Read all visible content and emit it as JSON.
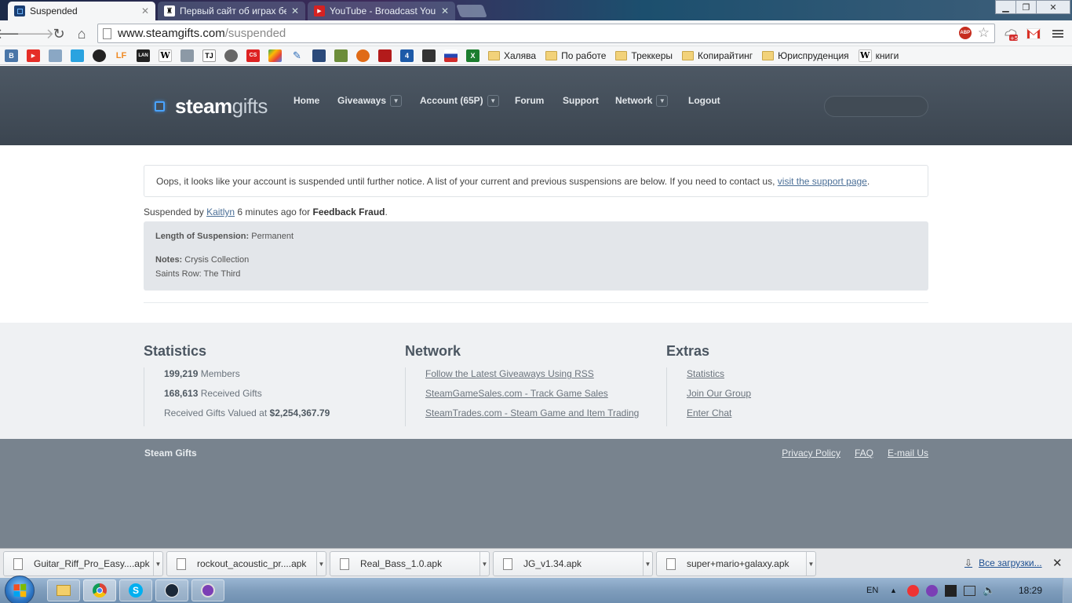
{
  "browser": {
    "tabs": [
      {
        "title": "Suspended",
        "active": true
      },
      {
        "title": "Первый сайт об играх без",
        "active": false
      },
      {
        "title": "YouTube - Broadcast Yours",
        "active": false
      }
    ],
    "url_host": "www.steamgifts.com",
    "url_path": "/suspended",
    "badge": "+5",
    "bookmark_icons": [
      "В",
      "▶",
      "",
      "",
      "",
      "LF",
      "LAN",
      "W",
      "",
      "TJ",
      "",
      "CS",
      "",
      "",
      "",
      "",
      "",
      "",
      "4",
      "",
      "",
      "X"
    ],
    "bookmark_folders": [
      "Халява",
      "По работе",
      "Треккеры",
      "Копирайтинг",
      "Юриспруденция"
    ],
    "bookmark_wiki": "книги"
  },
  "site": {
    "logo_a": "steam",
    "logo_b": "gifts",
    "nav": {
      "home": "Home",
      "giveaways": "Giveaways",
      "account": "Account (65P)",
      "forum": "Forum",
      "support": "Support",
      "network": "Network",
      "logout": "Logout"
    }
  },
  "content": {
    "notice_text": "Oops, it looks like your account is suspended until further notice. A list of your current and previous suspensions are below. If you need to contact us, ",
    "notice_link": "visit the support page",
    "notice_end": ".",
    "susp_prefix": "Suspended by ",
    "susp_user": "Kaitlyn",
    "susp_mid": " 6 minutes ago for ",
    "susp_reason": "Feedback Fraud",
    "susp_end": ".",
    "length_label": "Length of Suspension:",
    "length_value": "Permanent",
    "notes_label": "Notes:",
    "notes_line1": "Crysis Collection",
    "notes_line2": "Saints Row: The Third"
  },
  "footer": {
    "statistics": {
      "heading": "Statistics",
      "members_num": "199,219",
      "members_label": "Members",
      "gifts_num": "168,613",
      "gifts_label": "Received Gifts",
      "value_label": "Received Gifts Valued at",
      "value_num": "$2,254,367.79"
    },
    "network": {
      "heading": "Network",
      "links": [
        "Follow the Latest Giveaways Using RSS",
        "SteamGameSales.com - Track Game Sales",
        "SteamTrades.com - Steam Game and Item Trading"
      ]
    },
    "extras": {
      "heading": "Extras",
      "links": [
        "Statistics",
        "Join Our Group",
        "Enter Chat"
      ]
    },
    "site_name": "Steam Gifts",
    "bottom_links": [
      "Privacy Policy",
      "FAQ",
      "E-mail Us"
    ]
  },
  "downloads": {
    "files": [
      "Guitar_Riff_Pro_Easy....apk",
      "rockout_acoustic_pr....apk",
      "Real_Bass_1.0.apk",
      "JG_v1.34.apk",
      "super+mario+galaxy.apk"
    ],
    "all_label": "Все загрузки..."
  },
  "taskbar": {
    "lang": "EN",
    "time": "18:29"
  },
  "colors": {
    "header_bg": "#434d58",
    "logo_accent": "#4aa3ff",
    "link": "#4b6f97",
    "footer_bar": "#78838e"
  }
}
